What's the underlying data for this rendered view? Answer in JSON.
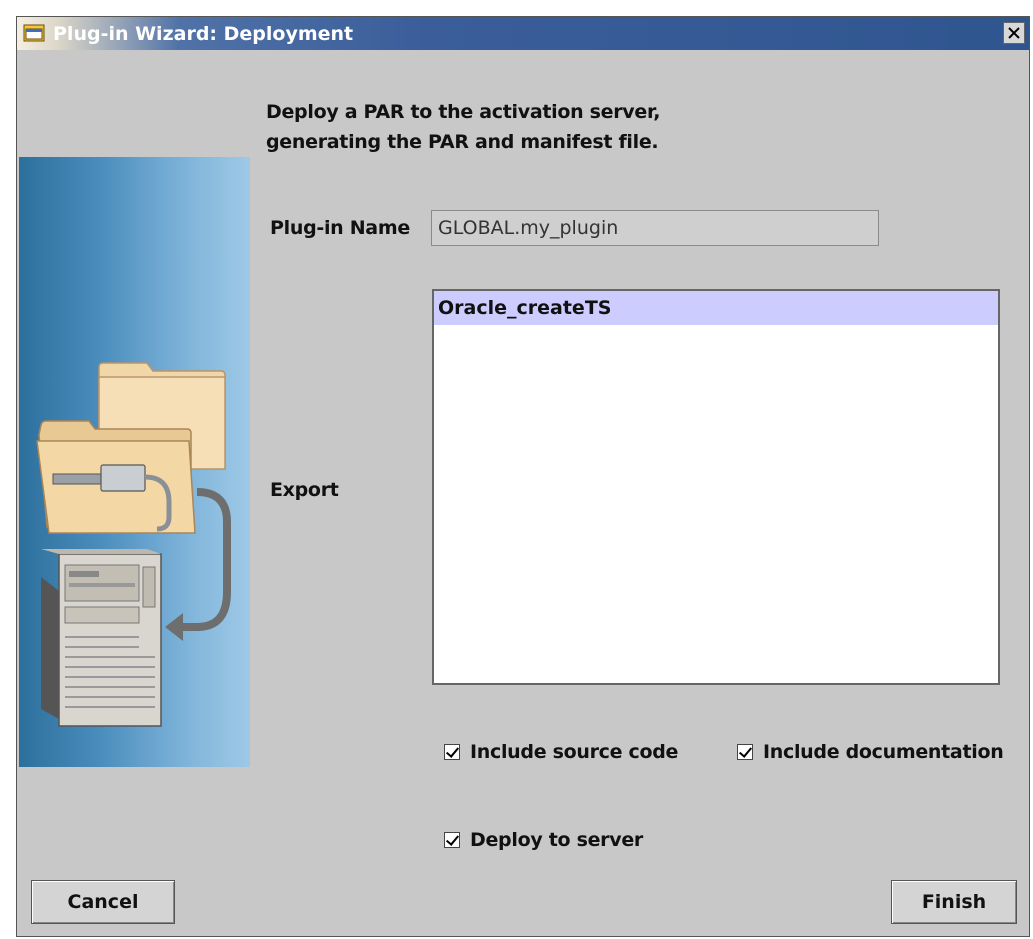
{
  "window": {
    "title": "Plug-in Wizard: Deployment",
    "close_glyph": "×"
  },
  "description": {
    "line1": "Deploy a PAR to the activation server,",
    "line2": "generating the PAR and manifest file."
  },
  "plugin": {
    "label": "Plug-in Name",
    "value": "GLOBAL.my_plugin"
  },
  "export": {
    "label": "Export",
    "items": [
      "Oracle_createTS"
    ],
    "selected_index": 0
  },
  "options": {
    "include_source": {
      "label": "Include source code",
      "checked": true
    },
    "include_docs": {
      "label": "Include documentation",
      "checked": true
    },
    "deploy_server": {
      "label": "Deploy to server",
      "checked": true
    }
  },
  "buttons": {
    "cancel": "Cancel",
    "finish": "Finish"
  },
  "icons": {
    "title": "wizard-window-icon",
    "close": "close-icon",
    "illustration": "deploy-illustration-icon"
  },
  "colors": {
    "titlebar": "#2f558f",
    "dialog_bg": "#c8c8c8",
    "selection": "#ccccff"
  }
}
